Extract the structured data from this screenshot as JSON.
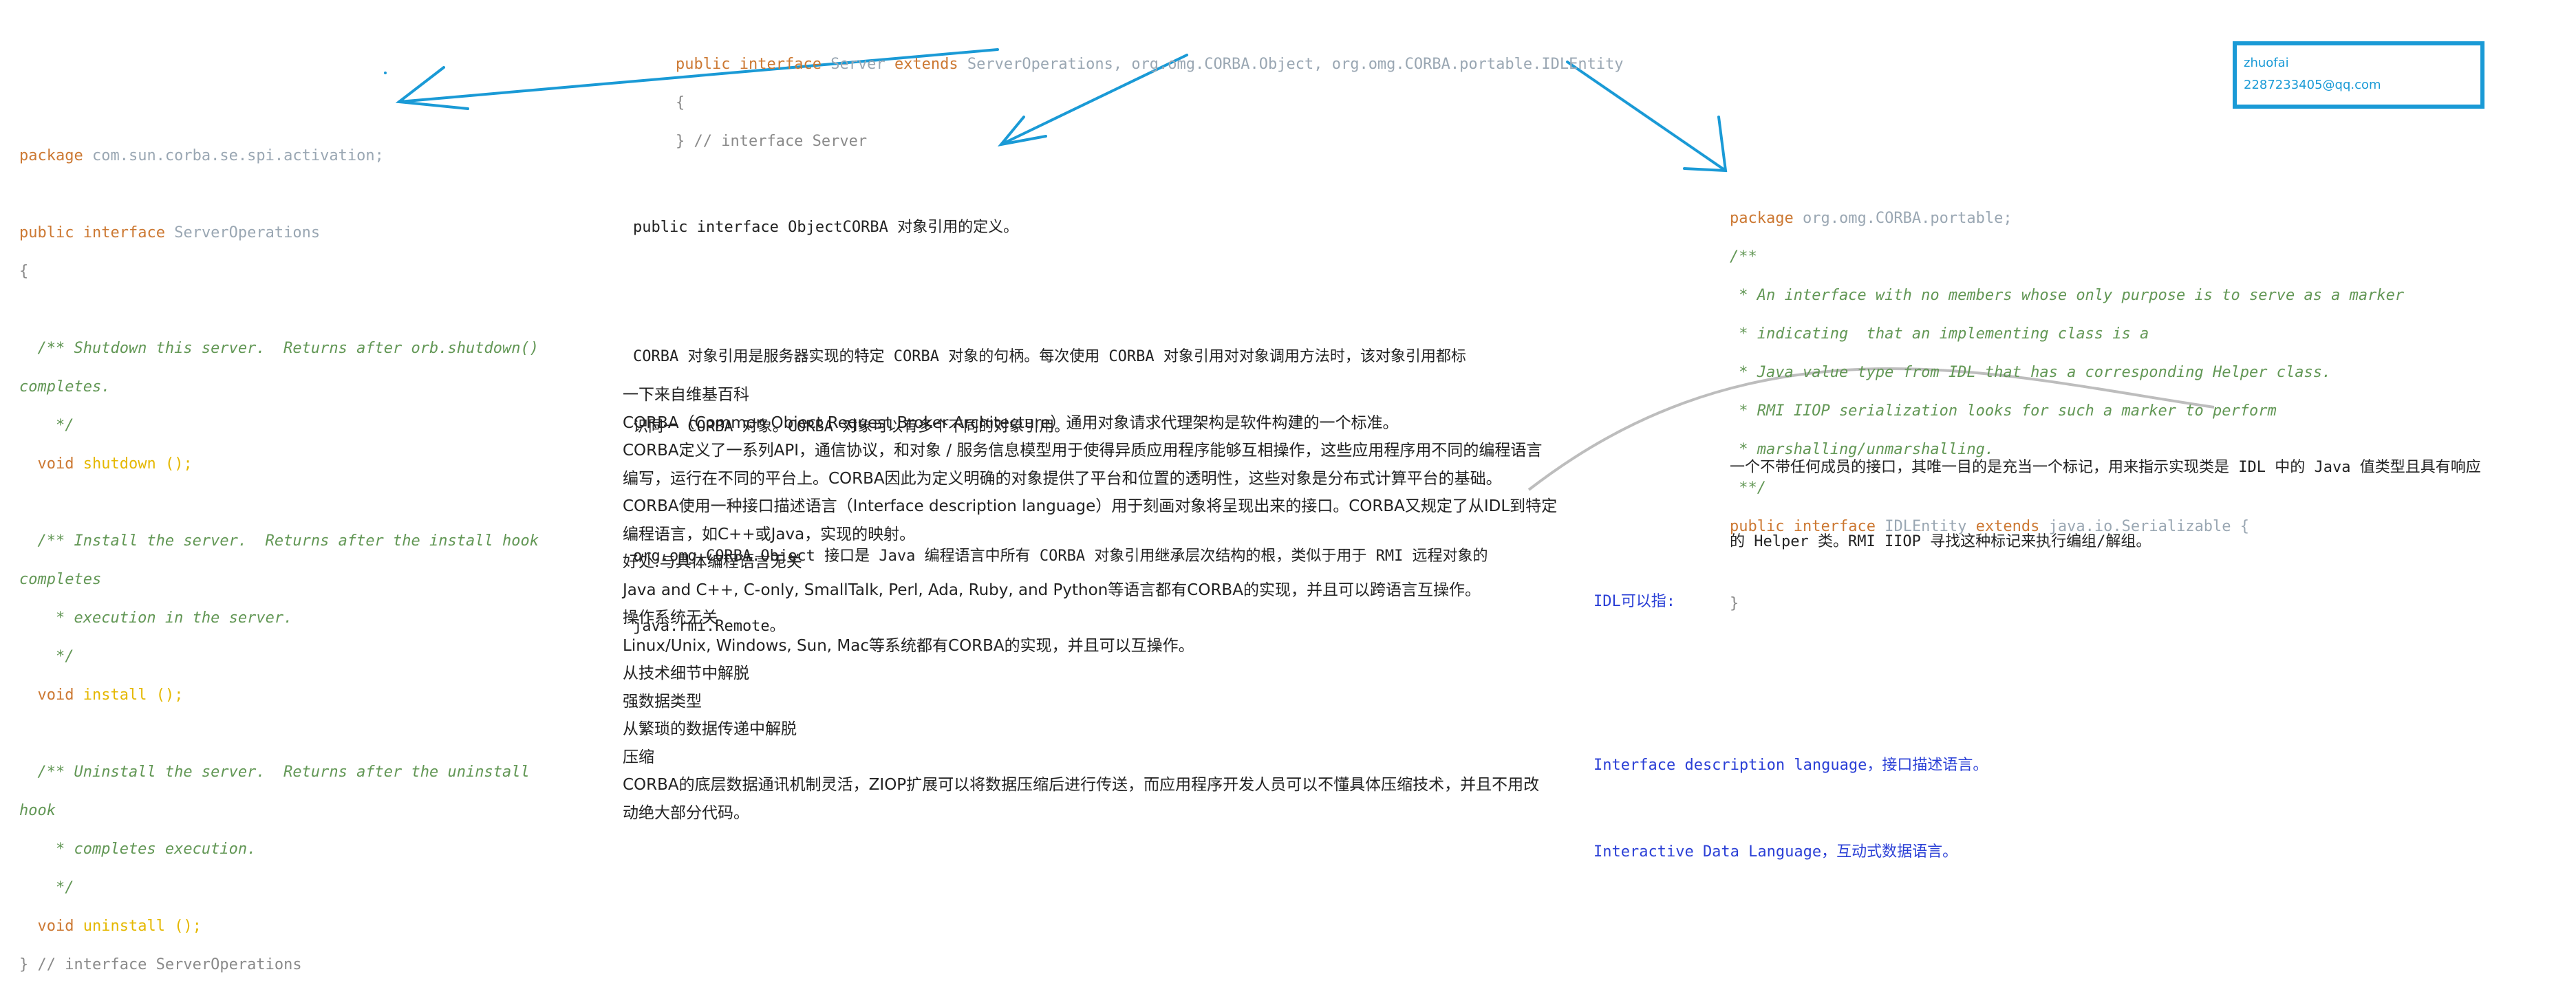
{
  "colors": {
    "keyword": "#cc7832",
    "type": "#9aa7b3",
    "comment": "#629755",
    "method": "#e5b800",
    "arrow": "#1a9ad6",
    "idl_blue": "#2a3fd6"
  },
  "top_code": {
    "line1": {
      "kw1": "public",
      "kw2": "interface",
      "name": "Server",
      "kw3": "extends",
      "rest": "ServerOperations, org.omg.CORBA.Object, org.omg.CORBA.portable.IDLEntity"
    },
    "line2": "{",
    "line3": "} // interface Server"
  },
  "left_code": {
    "package_kw": "package",
    "package_name": "com.sun.corba.se.spi.activation;",
    "decl_kw1": "public",
    "decl_kw2": "interface",
    "decl_name": "ServerOperations",
    "open_brace": "{",
    "c1a": "  /** Shutdown this server.  Returns after orb.shutdown()",
    "c1b": "completes.",
    "c1c": "    */",
    "m1_kw": "  void",
    "m1_name": "shutdown",
    "m1_tail": " ();",
    "c2a": "  /** Install the server.  Returns after the install hook",
    "c2b": "completes",
    "c2c": "    * execution in the server.",
    "c2d": "    */",
    "m2_kw": "  void",
    "m2_name": "install",
    "m2_tail": " ();",
    "c3a": "  /** Uninstall the server.  Returns after the uninstall",
    "c3b": "hook",
    "c3c": "    * completes execution.",
    "c3d": "    */",
    "m3_kw": "  void",
    "m3_name": "uninstall",
    "m3_tail": " ();",
    "close": "} // interface ServerOperations"
  },
  "object_desc": {
    "p1": "public interface ObjectCORBA 对象引用的定义。",
    "p2a": "CORBA 对象引用是服务器实现的特定 CORBA 对象的句柄。每次使用 CORBA 对象引用对对象调用方法时，该对象引用都标",
    "p2b": "识同一 CORBA 对象。CORBA 对象可以有多个不同的对象引用。",
    "p3a": "org.omg.CORBA.Object 接口是 Java 编程语言中所有 CORBA 对象引用继承层次结构的根，类似于用于 RMI 远程对象的",
    "p3b": "java.rmi.Remote。"
  },
  "wiki_lines": [
    "一下来自维基百科",
    "CORBA（Common Object Request Broker Architecture）通用对象请求代理架构是软件构建的一个标准。",
    "CORBA定义了一系列API，通信协议，和对象 / 服务信息模型用于使得异质应用程序能够互相操作，这些应用程序用不同的编程语言",
    "编写，运行在不同的平台上。CORBA因此为定义明确的对象提供了平台和位置的透明性，这些对象是分布式计算平台的基础。",
    "CORBA使用一种接口描述语言（Interface description language）用于刻画对象将呈现出来的接口。CORBA又规定了从IDL到特定",
    "编程语言，如C++或Java，实现的映射。",
    "好处:与具体编程语言无关",
    "Java and C++, C-only, SmallTalk, Perl, Ada, Ruby, and Python等语言都有CORBA的实现，并且可以跨语言互操作。",
    "操作系统无关",
    "Linux/Unix, Windows, Sun, Mac等系统都有CORBA的实现，并且可以互操作。",
    "从技术细节中解脱",
    "强数据类型",
    "从繁琐的数据传递中解脱",
    "压缩",
    "CORBA的底层数据通讯机制灵活，ZIOP扩展可以将数据压缩后进行传送，而应用程序开发人员可以不懂具体压缩技术，并且不用改",
    "动绝大部分代码。"
  ],
  "right_code": {
    "package_kw": "package",
    "package_name": "org.omg.CORBA.portable;",
    "c0": "/**",
    "c1": " * An interface with no members whose only purpose is to serve as a marker",
    "c2": " * indicating  that an implementing class is a",
    "c3": " * Java value type from IDL that has a corresponding Helper class.",
    "c4": " * RMI IIOP serialization looks for such a marker to perform",
    "c5": " * marshalling/unmarshalling.",
    "c6": " **/",
    "decl_kw1": "public",
    "decl_kw2": "interface",
    "decl_name": "IDLEntity",
    "decl_kw3": "extends",
    "decl_rest": "java.io.Serializable {",
    "close": "}"
  },
  "idl_entity_desc": {
    "line1": "一个不带任何成员的接口，其唯一目的是充当一个标记，用来指示实现类是 IDL 中的 Java 值类型且具有响应",
    "line2": "的 Helper 类。RMI IIOP 寻找这种标记来执行编组/解组。"
  },
  "idl_meaning": {
    "title": "IDL可以指:",
    "item1": "Interface description language，接口描述语言。",
    "item2": "Interactive Data Language，互动式数据语言。"
  },
  "contact": {
    "name": "zhuofai",
    "email": "2287233405@qq.com"
  }
}
